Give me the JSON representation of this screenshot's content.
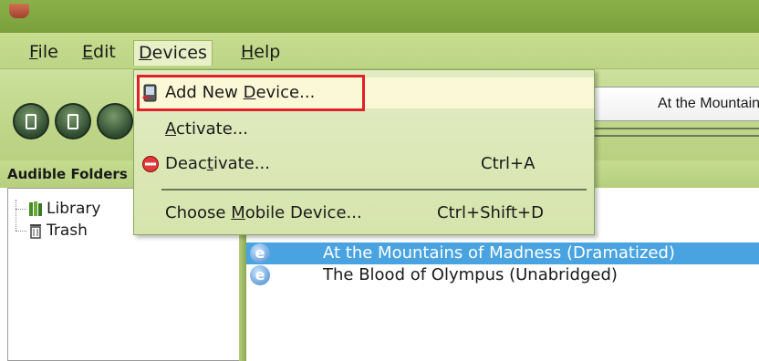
{
  "menubar": {
    "items": [
      {
        "label": "File",
        "accel": "F",
        "rest": "ile"
      },
      {
        "label": "Edit",
        "accel": "E",
        "rest": "dit"
      },
      {
        "label": "Devices",
        "accel": "D",
        "rest": "evices"
      },
      {
        "label": "Help",
        "accel": "H",
        "rest": "elp"
      }
    ]
  },
  "devices_menu": {
    "items": [
      {
        "pre": "Add New ",
        "accel": "D",
        "post": "evice...",
        "shortcut": "",
        "icon": "add-device-icon"
      },
      {
        "pre": "",
        "accel": "A",
        "post": "ctivate...",
        "shortcut": "",
        "icon": ""
      },
      {
        "pre": "Deac",
        "accel": "t",
        "post": "ivate...",
        "shortcut": "Ctrl+A",
        "icon": "deactivate-icon"
      },
      {
        "pre": "Choose ",
        "accel": "M",
        "post": "obile Device...",
        "shortcut": "Ctrl+Shift+D",
        "icon": ""
      }
    ]
  },
  "toolbar": {
    "now_playing": "At the Mountains of Madness (Dramatized)"
  },
  "folders": {
    "header": "Audible Folders",
    "items": [
      {
        "label": "Library",
        "icon": "library-icon"
      },
      {
        "label": "Trash",
        "icon": "trash-icon"
      }
    ]
  },
  "titles": {
    "rows": [
      {
        "title": "At the Mountains of Madness (Dramatized)",
        "selected": true,
        "icon": "e"
      },
      {
        "title": "The Blood of Olympus (Unabridged)",
        "selected": false,
        "icon": "e"
      }
    ]
  },
  "colors": {
    "highlight_box": "#e0202a",
    "selection": "#49a3e0",
    "menu_bg": "#e2ecc4",
    "chrome_green": "#bcd585"
  }
}
